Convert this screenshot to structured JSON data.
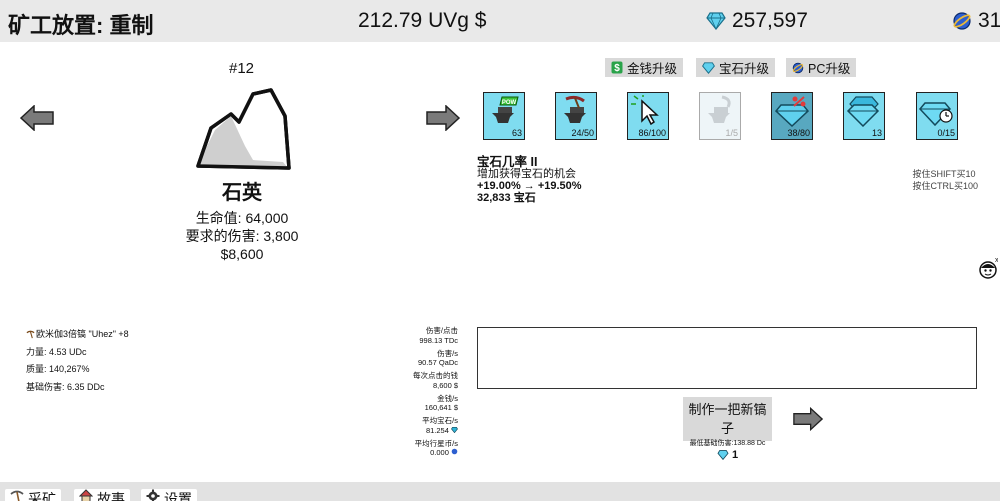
{
  "header": {
    "title": "矿工放置: 重制",
    "money": "212.79 UVg $",
    "gems": "257,597",
    "planet_coins": "31"
  },
  "rock": {
    "number": "#12",
    "name": "石英",
    "hp": "生命值: 64,000",
    "required_damage": "要求的伤害: 3,800",
    "value": "$8,600"
  },
  "upgrade_tabs": [
    {
      "label": "金钱升级",
      "icon": "dollar-icon"
    },
    {
      "label": "宝石升级",
      "icon": "gem-icon"
    },
    {
      "label": "PC升级",
      "icon": "planet-coin-icon"
    }
  ],
  "upgrades": [
    {
      "count": "63",
      "icon": "anvil-pow-icon"
    },
    {
      "count": "24/50",
      "icon": "anvil-pickaxe-icon"
    },
    {
      "count": "86/100",
      "icon": "cursor-click-icon"
    },
    {
      "count": "1/5",
      "icon": "anvil-shadow-icon"
    },
    {
      "count": "38/80",
      "icon": "gem-percent-icon"
    },
    {
      "count": "13",
      "icon": "double-gem-icon"
    },
    {
      "count": "0/15",
      "icon": "gem-clock-icon"
    }
  ],
  "selected_upgrade": {
    "name": "宝石几率 II",
    "description": "增加获得宝石的机会",
    "change": "+19.00% → +19.50%",
    "cost": "32,833 宝石"
  },
  "hints": {
    "shift": "按住SHIFT买10",
    "ctrl": "按住CTRL买100"
  },
  "pickaxe": {
    "name": "欧米伽3倍镐 \"Uhez\" +8",
    "power": "力量: 4.53 UDc",
    "quality": "质量: 140,267%",
    "base_damage": "基础伤害: 6.35 DDc"
  },
  "stats": {
    "dmg_per_click_label": "伤害/点击",
    "dmg_per_click": "998.13 TDc",
    "dmg_per_sec_label": "伤害/s",
    "dmg_per_sec": "90.57 QaDc",
    "money_per_click_label": "每次点击的钱",
    "money_per_click": "8,600 $",
    "money_per_sec_label": "金钱/s",
    "money_per_sec": "160,641 $",
    "gems_per_sec_label": "平均宝石/s",
    "gems_per_sec": "81.254",
    "planet_per_sec_label": "平均行星币/s",
    "planet_per_sec": "0.000"
  },
  "craft": {
    "title": "制作一把新镐子",
    "min_damage": "最低基础伤害:138.88 Dc",
    "cost": "1"
  },
  "bottom_tabs": [
    {
      "label": "采矿",
      "icon": "pickaxe-icon"
    },
    {
      "label": "故事",
      "icon": "house-icon"
    },
    {
      "label": "设置",
      "icon": "gear-icon"
    }
  ],
  "colors": {
    "gem": "#2fb4d8",
    "tile": "#7fdcf0",
    "header_bg": "#e9e9e9",
    "tab_bg": "#d9d9d9"
  }
}
